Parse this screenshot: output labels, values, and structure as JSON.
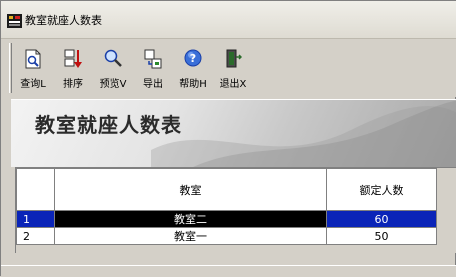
{
  "window": {
    "title": "教室就座人数表"
  },
  "toolbar": {
    "items": [
      {
        "label": "查询L",
        "icon": "query-document-icon"
      },
      {
        "label": "排序",
        "icon": "sort-icon"
      },
      {
        "label": "预览V",
        "icon": "preview-magnifier-icon"
      },
      {
        "label": "导出",
        "icon": "export-icon"
      },
      {
        "label": "帮助H",
        "icon": "help-icon"
      },
      {
        "label": "退出X",
        "icon": "exit-door-icon"
      }
    ]
  },
  "banner": {
    "title": "教室就座人数表"
  },
  "grid": {
    "columns": [
      "",
      "教室",
      "额定人数"
    ],
    "rows": [
      {
        "idx": "1",
        "room": "教室二",
        "count": "60",
        "selected": true
      },
      {
        "idx": "2",
        "room": "教室一",
        "count": "50",
        "selected": false
      }
    ]
  },
  "colors": {
    "selection": "#0a24b8",
    "window_bg": "#d4d0c8"
  }
}
